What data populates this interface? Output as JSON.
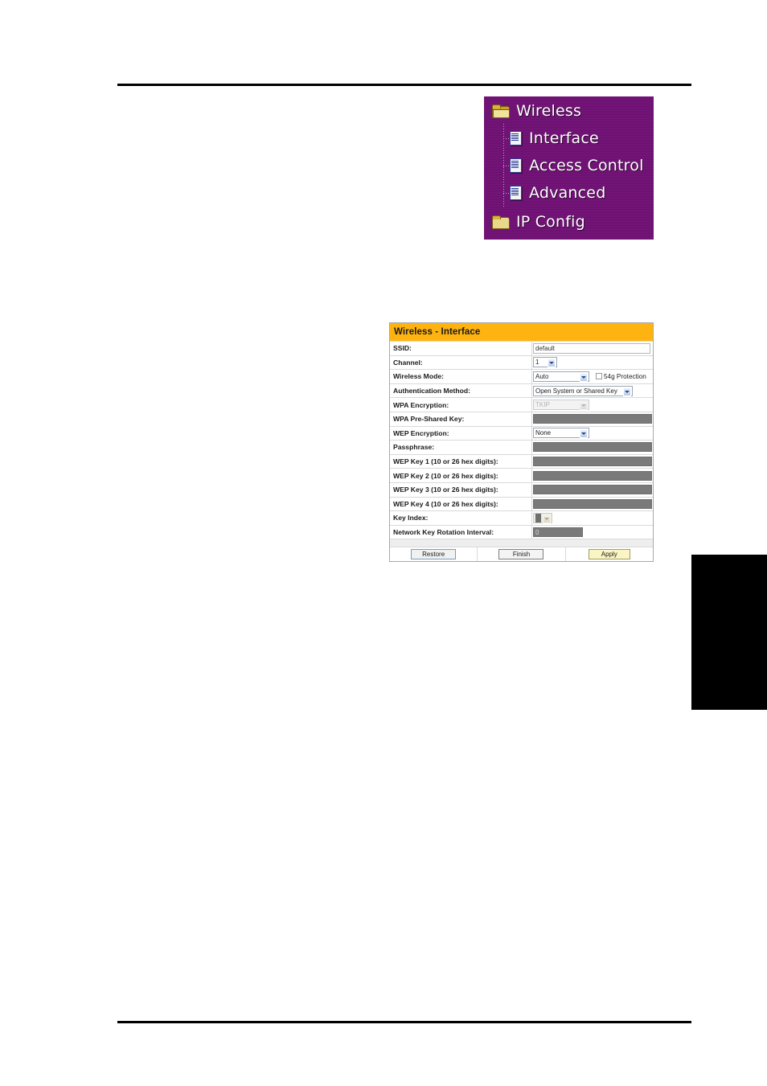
{
  "page": {
    "rules": {
      "top_label": "header-rule",
      "bottom_label": "footer-rule"
    },
    "side_tab_label": ""
  },
  "menu": {
    "items": [
      {
        "label": "Wireless",
        "icon": "folder-open-icon",
        "level": "top",
        "expanded": true
      },
      {
        "label": "Interface",
        "icon": "page-icon",
        "level": "child",
        "expanded": false
      },
      {
        "label": "Access Control",
        "icon": "page-icon",
        "level": "child",
        "expanded": false
      },
      {
        "label": "Advanced",
        "icon": "page-icon",
        "level": "child",
        "expanded": false
      },
      {
        "label": "IP Config",
        "icon": "folder-closed-icon",
        "level": "top",
        "expanded": false
      }
    ],
    "background_color": "#6d0f72"
  },
  "config": {
    "title": "Wireless - Interface",
    "header_color": "#FFB310",
    "rows": [
      {
        "label": "SSID:",
        "control": "text",
        "value": "default"
      },
      {
        "label": "Channel:",
        "control": "select",
        "value": "1"
      },
      {
        "label": "Wireless Mode:",
        "control": "select",
        "value": "Auto",
        "checkbox_label": "54g Protection",
        "checkbox_checked": false
      },
      {
        "label": "Authentication Method:",
        "control": "select",
        "value": "Open System or Shared Key"
      },
      {
        "label": "WPA Encryption:",
        "control": "select-disabled",
        "value": "TKIP"
      },
      {
        "label": "WPA Pre-Shared Key:",
        "control": "grey",
        "value": ""
      },
      {
        "label": "WEP Encryption:",
        "control": "select",
        "value": "None"
      },
      {
        "label": "Passphrase:",
        "control": "grey",
        "value": ""
      },
      {
        "label": "WEP Key 1 (10 or 26 hex digits):",
        "control": "grey",
        "value": ""
      },
      {
        "label": "WEP Key 2 (10 or 26 hex digits):",
        "control": "grey",
        "value": ""
      },
      {
        "label": "WEP Key 3 (10 or 26 hex digits):",
        "control": "grey",
        "value": ""
      },
      {
        "label": "WEP Key 4 (10 or 26 hex digits):",
        "control": "grey",
        "value": ""
      },
      {
        "label": "Key Index:",
        "control": "key-index",
        "value": "1"
      },
      {
        "label": "Network Key Rotation Interval:",
        "control": "grey-small",
        "value": "0"
      }
    ],
    "buttons": [
      {
        "label": "Restore",
        "style": "blue"
      },
      {
        "label": "Finish",
        "style": "grey"
      },
      {
        "label": "Apply",
        "style": "apply"
      }
    ]
  }
}
